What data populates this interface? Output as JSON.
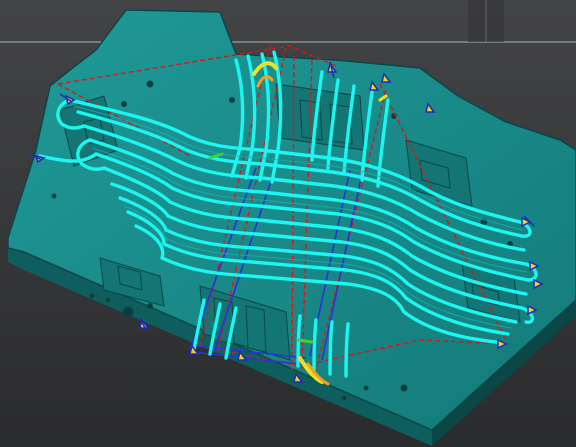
{
  "viewport": {
    "background": "#3c3d3f",
    "gradient_bottom": "#2a2b2d"
  },
  "model": {
    "part": "mold plate",
    "toolpath_count": 14
  },
  "colors": {
    "plate_top": "#1a8a8a",
    "plate_side": "#0f5e5e",
    "plate_edge": "#0b4747",
    "toolpath": "#1df5f0",
    "toolpath_dark": "#0fb7b4",
    "boundary_dashed": "#d21a1a",
    "guide_line": "#2435d6",
    "tool_tip": "#f3d21b",
    "tool_marker": "#1b2bbd",
    "highlight": "#f0e02a",
    "crosshair": "#d8d8d8"
  },
  "icons": {
    "crosshair": "crosshair-icon",
    "tool_marker": "tool-marker-icon"
  }
}
